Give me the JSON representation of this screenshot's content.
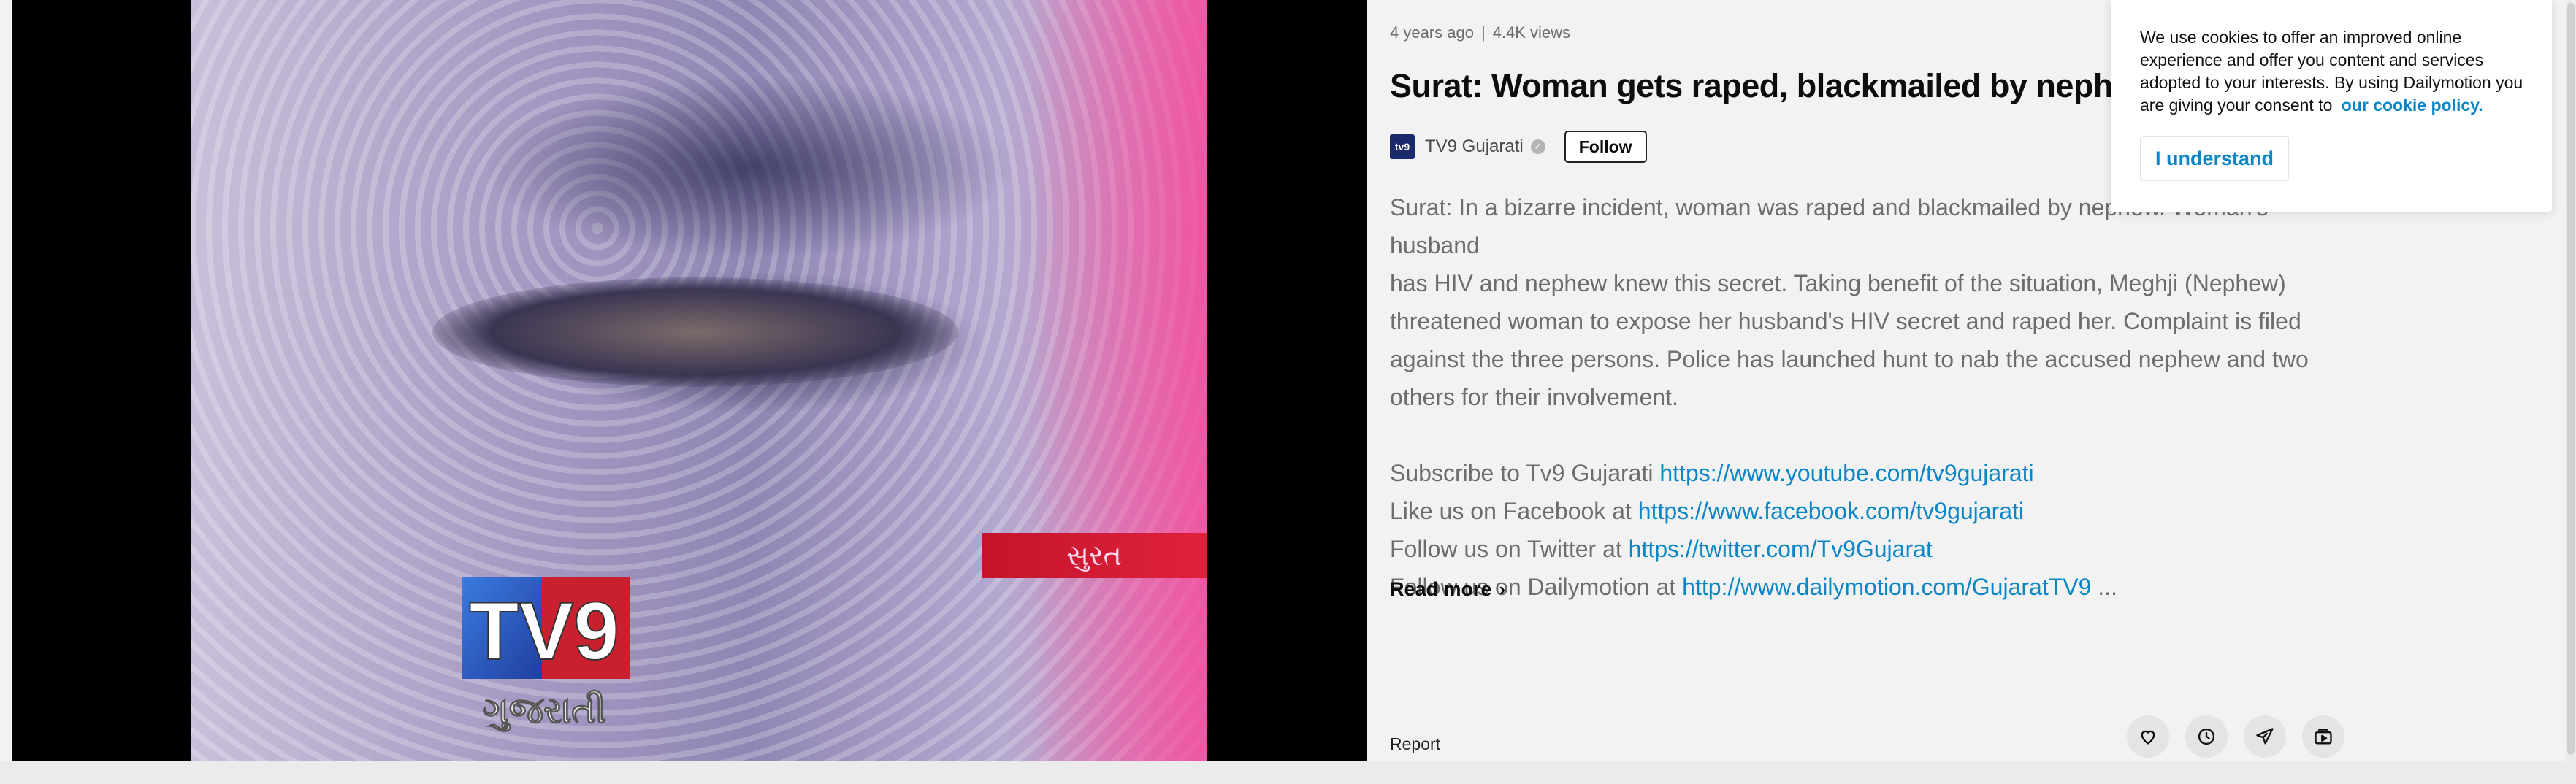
{
  "player": {
    "place_banner": "સુરત",
    "logo": {
      "text": "TV9",
      "subtext": "ગુજરાતી"
    }
  },
  "video": {
    "age": "4 years ago",
    "separator": "|",
    "views": "4.4K views",
    "title": "Surat: Woman gets raped, blackmailed by nephew"
  },
  "channel": {
    "avatar_text": "tv9",
    "name": "TV9 Gujarati",
    "follow_label": "Follow"
  },
  "description": {
    "lines": [
      "Surat: In a bizarre incident, woman was raped and blackmailed by nephew. Woman's husband",
      "has HIV and nephew knew this secret. Taking benefit of the situation, Meghji (Nephew)",
      "threatened woman to expose her husband's HIV secret and raped her. Complaint is filed",
      "against the three persons. Police has launched hunt to nab the accused nephew and two",
      "others for their involvement."
    ],
    "links": [
      {
        "prefix": "Subscribe to Tv9 Gujarati ",
        "url": "https://www.youtube.com/tv9gujarati",
        "suffix": ""
      },
      {
        "prefix": "Like us on Facebook at ",
        "url": "https://www.facebook.com/tv9gujarati",
        "suffix": ""
      },
      {
        "prefix": "Follow us on Twitter at ",
        "url": "https://twitter.com/Tv9Gujarat",
        "suffix": ""
      },
      {
        "prefix": "Follow us on Dailymotion at ",
        "url": "http://www.dailymotion.com/GujaratTV9",
        "suffix": " ..."
      }
    ],
    "read_more": "Read more"
  },
  "report_label": "Report",
  "actions": [
    {
      "name": "like-button",
      "icon": "heart-icon"
    },
    {
      "name": "watch-later-button",
      "icon": "clock-icon"
    },
    {
      "name": "share-button",
      "icon": "send-icon"
    },
    {
      "name": "add-to-playlist-button",
      "icon": "playlist-add-icon"
    }
  ],
  "cookie": {
    "text": "We use cookies to offer an improved online experience and offer you content and services adopted to your interests. By using Dailymotion you are giving your consent to",
    "link": "our cookie policy.",
    "button": "I understand"
  },
  "colors": {
    "accent": "#0a86c7",
    "page_bg": "#f2f2f2",
    "player_bg": "#000000",
    "banner_red": "#d91b35"
  }
}
